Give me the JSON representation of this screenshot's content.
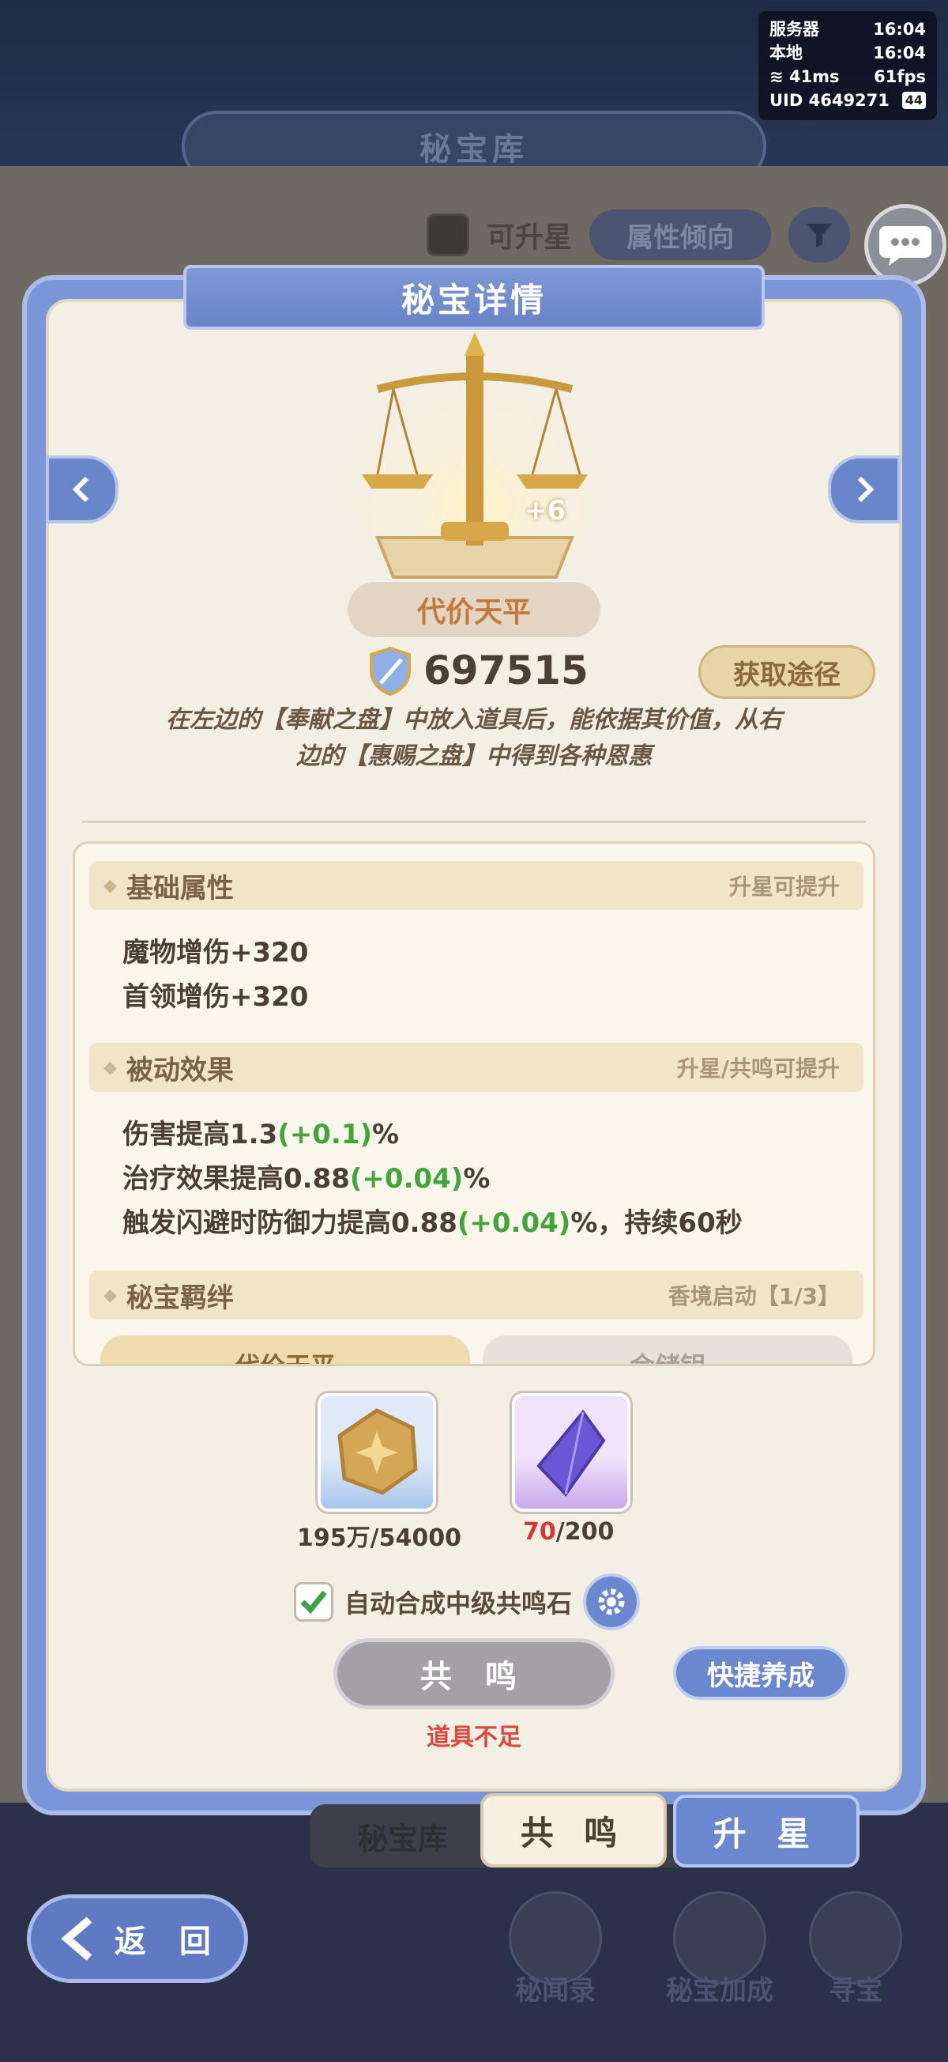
{
  "status": {
    "server_label": "服务器",
    "server_time": "16:04",
    "local_label": "本地",
    "local_time": "16:04",
    "ping": "41ms",
    "fps": "61fps",
    "uid": "UID 4649271",
    "battery": "44"
  },
  "background": {
    "title": "秘宝库",
    "filter_label": "可升星",
    "attr_pill": "属性倾向"
  },
  "panel": {
    "header": "秘宝详情",
    "level": "+6",
    "item_name": "代价天平",
    "power": "697515",
    "get_button": "获取途径",
    "description_line1": "在左边的【奉献之盘】中放入道具后，能依据其价值，从右",
    "description_line2": "边的【惠赐之盘】中得到各种恩惠"
  },
  "sections": {
    "basic": {
      "title": "基础属性",
      "hint": "升星可提升",
      "lines": [
        "魔物增伤+320",
        "首领增伤+320"
      ]
    },
    "passive": {
      "title": "被动效果",
      "hint": "升星/共鸣可提升",
      "line1_pre": "伤害提高1.3",
      "line1_bonus": "(+0.1)",
      "line1_post": "%",
      "line2_pre": "治疗效果提高0.88",
      "line2_bonus": "(+0.04)",
      "line2_post": "%",
      "line3_pre": "触发闪避时防御力提高0.88",
      "line3_bonus": "(+0.04)",
      "line3_post": "%，持续60秒"
    },
    "bond": {
      "title": "秘宝羁绊",
      "hint": "香境启动【1/3】",
      "pill_a": "代价天平",
      "pill_b": "金储钥"
    }
  },
  "materials": {
    "coin_owned": "195万",
    "coin_need": "/54000",
    "crystal_owned": "70",
    "crystal_need": "/200"
  },
  "auto_merge_label": "自动合成中级共鸣石",
  "resonate_button": "共 鸣",
  "quick_button": "快捷养成",
  "insufficient": "道具不足",
  "tabs": {
    "library": "秘宝库",
    "resonate": "共 鸣",
    "star": "升 星"
  },
  "back_button": "返 回",
  "bottom_nav": [
    "秘闻录",
    "秘宝加成",
    "寻宝"
  ],
  "colors": {
    "accent": "#6b87cd",
    "bonus_green": "#41a53a",
    "warning_red": "#d9493f"
  }
}
